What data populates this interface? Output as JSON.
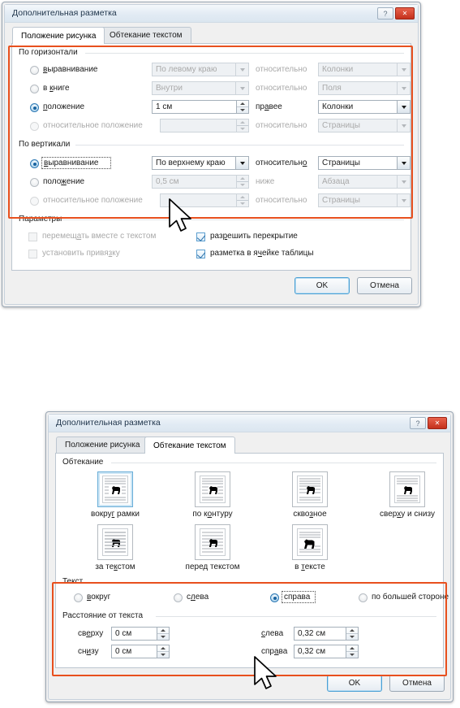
{
  "dialog1": {
    "title": "Дополнительная разметка",
    "titlebar_buttons": [
      {
        "name": "help-button",
        "glyph": "?"
      },
      {
        "name": "close-button",
        "glyph": "✕"
      }
    ],
    "tabs": [
      {
        "label": "Положение рисунка",
        "active": true
      },
      {
        "label": "Обтекание текстом",
        "active": false
      }
    ],
    "horizontal": {
      "group_label": "По горизонтали",
      "rows": [
        {
          "radio_label": "выравнивание",
          "selected": false,
          "disabled": false,
          "value": "По левому краю",
          "mid_label": "относительно",
          "relative_to": "Колонки",
          "control": "combo",
          "value_disabled": true
        },
        {
          "radio_label": "в книге",
          "selected": false,
          "disabled": false,
          "value": "Внутри",
          "mid_label": "относительно",
          "relative_to": "Поля",
          "control": "combo",
          "value_disabled": true
        },
        {
          "radio_label": "положение",
          "selected": true,
          "disabled": false,
          "value": "1 см",
          "mid_label": "правее",
          "relative_to": "Колонки",
          "control": "spin",
          "value_disabled": false
        },
        {
          "radio_label": "относительное положение",
          "selected": false,
          "disabled": true,
          "value": "",
          "mid_label": "относительно",
          "relative_to": "Страницы",
          "control": "spin",
          "value_disabled": true
        }
      ]
    },
    "vertical": {
      "group_label": "По вертикали",
      "rows": [
        {
          "radio_label": "выравнивание",
          "selected": true,
          "disabled": false,
          "value": "По верхнему краю",
          "mid_label": "относительно",
          "relative_to": "Страницы",
          "control": "combo",
          "value_disabled": false,
          "focused": true
        },
        {
          "radio_label": "положение",
          "selected": false,
          "disabled": false,
          "value": "0,5 см",
          "mid_label": "ниже",
          "relative_to": "Абзаца",
          "control": "spin",
          "value_disabled": true
        },
        {
          "radio_label": "относительное положение",
          "selected": false,
          "disabled": true,
          "value": "",
          "mid_label": "относительно",
          "relative_to": "Страницы",
          "control": "spin",
          "value_disabled": true
        }
      ]
    },
    "parameters": {
      "group_label": "Параметры",
      "checkboxes": [
        {
          "label": "перемещать вместе с текстом",
          "checked": false,
          "disabled": true
        },
        {
          "label": "установить привязку",
          "checked": false,
          "disabled": true
        },
        {
          "label": "разрешить перекрытие",
          "checked": true,
          "disabled": false
        },
        {
          "label": "разметка в ячейке таблицы",
          "checked": true,
          "disabled": false
        }
      ]
    },
    "buttons": {
      "ok": "OK",
      "cancel": "Отмена"
    }
  },
  "dialog2": {
    "title": "Дополнительная разметка",
    "titlebar_buttons": [
      {
        "name": "help-button",
        "glyph": "?"
      },
      {
        "name": "close-button",
        "glyph": "✕"
      }
    ],
    "tabs": [
      {
        "label": "Положение рисунка",
        "active": false
      },
      {
        "label": "Обтекание текстом",
        "active": true
      }
    ],
    "wrapping": {
      "group_label": "Обтекание",
      "items": [
        {
          "label": "вокруг рамки",
          "selected": true,
          "icon": "wrap-square-icon"
        },
        {
          "label": "по контуру",
          "selected": false,
          "icon": "wrap-tight-icon"
        },
        {
          "label": "сквозное",
          "selected": false,
          "icon": "wrap-through-icon"
        },
        {
          "label": "сверху и снизу",
          "selected": false,
          "icon": "wrap-topbottom-icon"
        },
        {
          "label": "за текстом",
          "selected": false,
          "icon": "wrap-behind-icon"
        },
        {
          "label": "перед текстом",
          "selected": false,
          "icon": "wrap-infront-icon"
        },
        {
          "label": "в тексте",
          "selected": false,
          "icon": "wrap-inline-icon"
        }
      ]
    },
    "text_side": {
      "group_label": "Текст",
      "options": [
        {
          "label": "вокруг",
          "selected": false
        },
        {
          "label": "слева",
          "selected": false
        },
        {
          "label": "справа",
          "selected": true
        },
        {
          "label": "по большей стороне",
          "selected": false
        }
      ]
    },
    "distance": {
      "group_label": "Расстояние от текста",
      "fields": [
        {
          "label": "сверху",
          "value": "0 см"
        },
        {
          "label": "снизу",
          "value": "0 см"
        },
        {
          "label": "слева",
          "value": "0,32 см"
        },
        {
          "label": "справа",
          "value": "0,32 см"
        }
      ]
    },
    "buttons": {
      "ok": "OK",
      "cancel": "Отмена"
    }
  },
  "annotation_color": "#e8501e"
}
